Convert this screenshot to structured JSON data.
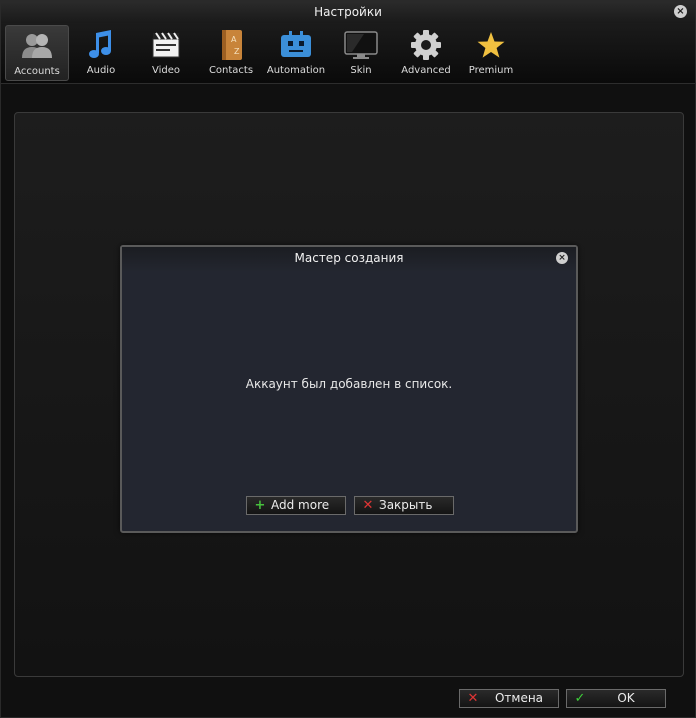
{
  "window": {
    "title": "Настройки"
  },
  "toolbar": {
    "items": [
      {
        "label": "Accounts",
        "icon": "accounts-icon"
      },
      {
        "label": "Audio",
        "icon": "music-note-icon"
      },
      {
        "label": "Video",
        "icon": "clapperboard-icon"
      },
      {
        "label": "Contacts",
        "icon": "address-book-icon"
      },
      {
        "label": "Automation",
        "icon": "robot-icon"
      },
      {
        "label": "Skin",
        "icon": "monitor-icon"
      },
      {
        "label": "Advanced",
        "icon": "gear-icon"
      },
      {
        "label": "Premium",
        "icon": "star-icon"
      }
    ]
  },
  "dialog": {
    "title": "Мастер создания",
    "message": "Аккаунт был добавлен в список.",
    "add_more_label": "Add more",
    "close_label": "Закрыть"
  },
  "footer": {
    "cancel_label": "Отмена",
    "ok_label": "OK"
  },
  "colors": {
    "background": "#101010",
    "dialog_bg": "#232630",
    "accent_green": "#47c13d",
    "accent_red": "#e03535",
    "star": "#f0c040"
  }
}
